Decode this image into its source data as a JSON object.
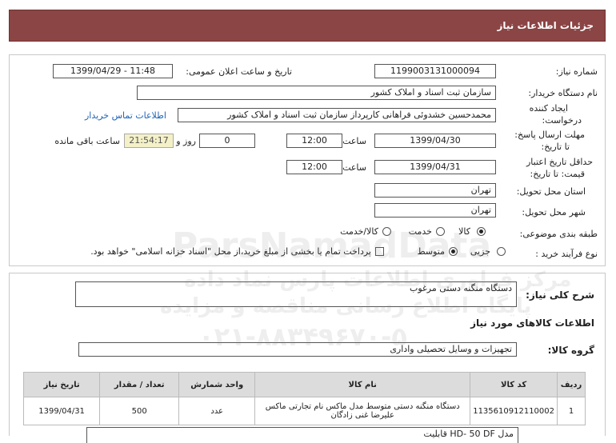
{
  "header": {
    "title": "جزئیات اطلاعات نیاز"
  },
  "fields": {
    "need_number_label": "شماره نیاز:",
    "need_number": "1199003131000094",
    "announce_label": "تاریخ و ساعت اعلان عمومی:",
    "announce_value": "1399/04/29 - 11:48",
    "buyer_org_label": "نام دستگاه خریدار:",
    "buyer_org": "سازمان ثبت اسناد و املاک کشور",
    "requester_label_1": "ایجاد کننده",
    "requester_label_2": "درخواست:",
    "requester": "محمدحسین خشدوئی فراهانی کارپرداز سازمان ثبت اسناد و املاک کشور",
    "contact_link": "اطلاعات تماس خریدار",
    "reply_deadline_label_1": "مهلت ارسال پاسخ:",
    "reply_deadline_label_2": "تا تاریخ:",
    "reply_date": "1399/04/30",
    "time_label": "ساعت",
    "reply_time": "12:00",
    "days_value": "0",
    "days_label": "روز و",
    "remaining_time": "21:54:17",
    "remaining_label": "ساعت باقی مانده",
    "validity_label_1": "حداقل تاریخ اعتبار",
    "validity_label_2": "قیمت: تا تاریخ:",
    "validity_date": "1399/04/31",
    "validity_time_label": "ساعت",
    "validity_time": "12:00",
    "province_label": "استان محل تحویل:",
    "province": "تهران",
    "city_label": "شهر محل تحویل:",
    "city": "تهران",
    "category_label": "طبقه بندی موضوعی:",
    "category_options": [
      "کالا",
      "خدمت",
      "کالا/خدمت"
    ],
    "purchase_type_label": "نوع فرآیند خرید :",
    "purchase_options": [
      "جزیی",
      "متوسط"
    ],
    "payment_note": "پرداخت تمام یا بخشی از مبلغ خرید،از محل \"اسناد خزانه اسلامی\" خواهد بود."
  },
  "summary": {
    "label": "شرح کلی نیاز:",
    "text": "دستگاه منگنه دستی مرغوب"
  },
  "goods": {
    "section_title": "اطلاعات کالاهای مورد نیاز",
    "group_label": "گروه کالا:",
    "group_value": "تجهیزات و وسایل تحصیلی واداری",
    "columns": [
      "ردیف",
      "کد کالا",
      "نام کالا",
      "واحد شمارش",
      "تعداد / مقدار",
      "تاریخ نیاز"
    ],
    "rows": [
      {
        "row": "1",
        "code": "1135610912110002",
        "name": "دستگاه منگنه دستی متوسط مدل ماکس نام تجارتی ماکس علیرضا غنی زادگان",
        "unit": "عدد",
        "qty": "500",
        "date": "1399/04/31"
      }
    ],
    "partial_text": "مدل HD- 50 DF قابلیت"
  },
  "watermark": {
    "brand": "ParsNamadData",
    "line1": "مرکز فراوری اطلاعات پارس نماد داده",
    "line2": "پایگاه اطلاع رسانی مناقصه و مزایده",
    "phone": "۰۲۱-۸۸۳۴۹۶۷۰-۵"
  }
}
